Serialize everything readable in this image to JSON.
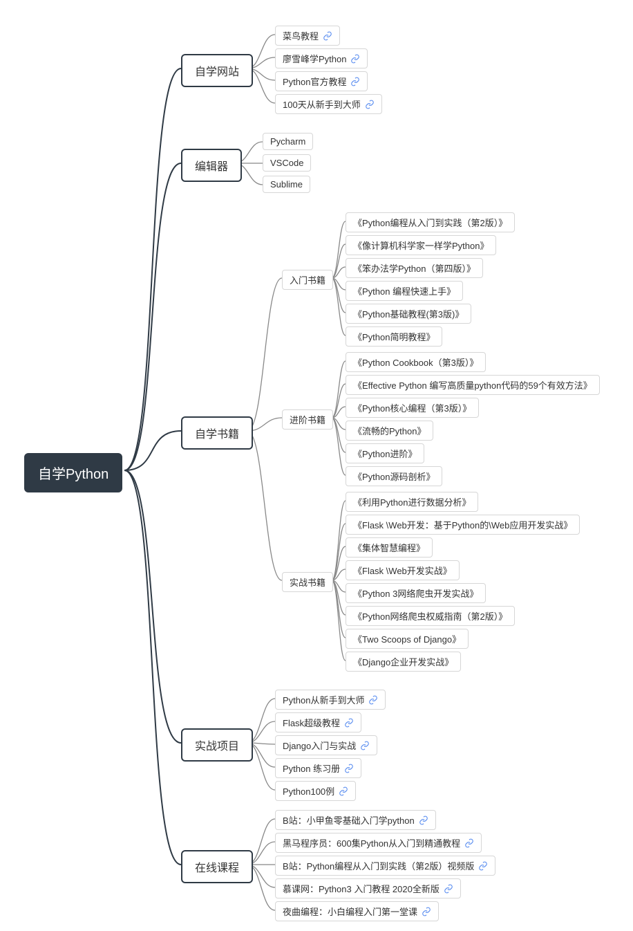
{
  "root": {
    "title": "自学Python"
  },
  "level1": {
    "websites": "自学网站",
    "editors": "编辑器",
    "books": "自学书籍",
    "projects": "实战项目",
    "courses": "在线课程"
  },
  "level2": {
    "books_intro": "入门书籍",
    "books_adv": "进阶书籍",
    "books_practice": "实战书籍"
  },
  "leaves": {
    "websites": [
      {
        "label": "菜鸟教程",
        "link": true
      },
      {
        "label": "廖雪峰学Python",
        "link": true
      },
      {
        "label": "Python官方教程",
        "link": true
      },
      {
        "label": "100天从新手到大师",
        "link": true
      }
    ],
    "editors": [
      {
        "label": "Pycharm",
        "link": false
      },
      {
        "label": "VSCode",
        "link": false
      },
      {
        "label": "Sublime",
        "link": false
      }
    ],
    "books_intro": [
      {
        "label": "《Python编程从入门到实践（第2版）》",
        "link": false
      },
      {
        "label": "《像计算机科学家一样学Python》",
        "link": false
      },
      {
        "label": "《笨办法学Python（第四版）》",
        "link": false
      },
      {
        "label": "《Python 编程快速上手》",
        "link": false
      },
      {
        "label": "《Python基础教程(第3版)》",
        "link": false
      },
      {
        "label": "《Python简明教程》",
        "link": false
      }
    ],
    "books_adv": [
      {
        "label": "《Python Cookbook（第3版）》",
        "link": false
      },
      {
        "label": "《Effective Python 编写高质量python代码的59个有效方法》",
        "link": false
      },
      {
        "label": "《Python核心编程（第3版）》",
        "link": false
      },
      {
        "label": "《流畅的Python》",
        "link": false
      },
      {
        "label": "《Python进阶》",
        "link": false
      },
      {
        "label": "《Python源码剖析》",
        "link": false
      }
    ],
    "books_practice": [
      {
        "label": "《利用Python进行数据分析》",
        "link": false
      },
      {
        "label": "《Flask \\Web开发：基于Python的\\Web应用开发实战》",
        "link": false
      },
      {
        "label": "《集体智慧编程》",
        "link": false
      },
      {
        "label": "《Flask \\Web开发实战》",
        "link": false
      },
      {
        "label": "《Python 3网络爬虫开发实战》",
        "link": false
      },
      {
        "label": "《Python网络爬虫权威指南（第2版）》",
        "link": false
      },
      {
        "label": "《Two Scoops of Django》",
        "link": false
      },
      {
        "label": "《Django企业开发实战》",
        "link": false
      }
    ],
    "projects": [
      {
        "label": "Python从新手到大师",
        "link": true
      },
      {
        "label": "Flask超级教程",
        "link": true
      },
      {
        "label": "Django入门与实战",
        "link": true
      },
      {
        "label": "Python 练习册",
        "link": true
      },
      {
        "label": "Python100例",
        "link": true
      }
    ],
    "courses": [
      {
        "label": "B站：小甲鱼零基础入门学python",
        "link": true
      },
      {
        "label": "黑马程序员：600集Python从入门到精通教程",
        "link": true
      },
      {
        "label": "B站：Python编程从入门到实践（第2版）视频版",
        "link": true
      },
      {
        "label": "慕课网：Python3 入门教程 2020全新版",
        "link": true
      },
      {
        "label": "夜曲编程：小白编程入门第一堂课",
        "link": true
      }
    ]
  }
}
